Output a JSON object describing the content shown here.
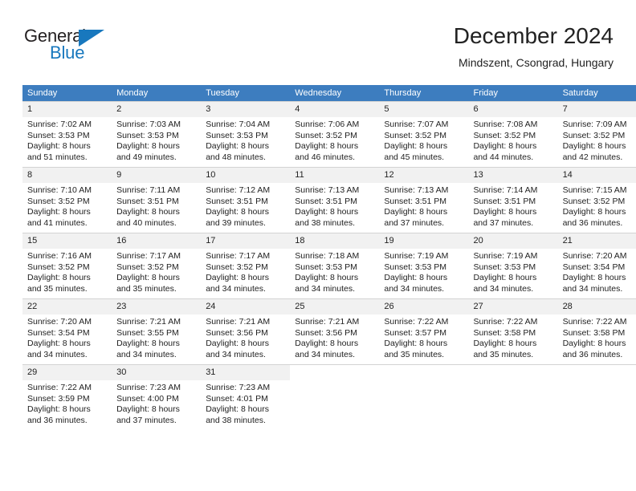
{
  "brand": {
    "name_top": "General",
    "name_bottom": "Blue",
    "color_dark": "#231f20",
    "color_blue": "#1878be"
  },
  "header": {
    "title": "December 2024",
    "subtitle": "Mindszent, Csongrad, Hungary"
  },
  "theme": {
    "header_bg": "#3d7dbf",
    "header_text": "#ffffff",
    "daynum_bg": "#f1f1f1",
    "grid_line": "#d3d3d3"
  },
  "weekdays": [
    "Sunday",
    "Monday",
    "Tuesday",
    "Wednesday",
    "Thursday",
    "Friday",
    "Saturday"
  ],
  "weeks": [
    [
      {
        "day": "1",
        "sunrise": "Sunrise: 7:02 AM",
        "sunset": "Sunset: 3:53 PM",
        "daylight1": "Daylight: 8 hours",
        "daylight2": "and 51 minutes."
      },
      {
        "day": "2",
        "sunrise": "Sunrise: 7:03 AM",
        "sunset": "Sunset: 3:53 PM",
        "daylight1": "Daylight: 8 hours",
        "daylight2": "and 49 minutes."
      },
      {
        "day": "3",
        "sunrise": "Sunrise: 7:04 AM",
        "sunset": "Sunset: 3:53 PM",
        "daylight1": "Daylight: 8 hours",
        "daylight2": "and 48 minutes."
      },
      {
        "day": "4",
        "sunrise": "Sunrise: 7:06 AM",
        "sunset": "Sunset: 3:52 PM",
        "daylight1": "Daylight: 8 hours",
        "daylight2": "and 46 minutes."
      },
      {
        "day": "5",
        "sunrise": "Sunrise: 7:07 AM",
        "sunset": "Sunset: 3:52 PM",
        "daylight1": "Daylight: 8 hours",
        "daylight2": "and 45 minutes."
      },
      {
        "day": "6",
        "sunrise": "Sunrise: 7:08 AM",
        "sunset": "Sunset: 3:52 PM",
        "daylight1": "Daylight: 8 hours",
        "daylight2": "and 44 minutes."
      },
      {
        "day": "7",
        "sunrise": "Sunrise: 7:09 AM",
        "sunset": "Sunset: 3:52 PM",
        "daylight1": "Daylight: 8 hours",
        "daylight2": "and 42 minutes."
      }
    ],
    [
      {
        "day": "8",
        "sunrise": "Sunrise: 7:10 AM",
        "sunset": "Sunset: 3:52 PM",
        "daylight1": "Daylight: 8 hours",
        "daylight2": "and 41 minutes."
      },
      {
        "day": "9",
        "sunrise": "Sunrise: 7:11 AM",
        "sunset": "Sunset: 3:51 PM",
        "daylight1": "Daylight: 8 hours",
        "daylight2": "and 40 minutes."
      },
      {
        "day": "10",
        "sunrise": "Sunrise: 7:12 AM",
        "sunset": "Sunset: 3:51 PM",
        "daylight1": "Daylight: 8 hours",
        "daylight2": "and 39 minutes."
      },
      {
        "day": "11",
        "sunrise": "Sunrise: 7:13 AM",
        "sunset": "Sunset: 3:51 PM",
        "daylight1": "Daylight: 8 hours",
        "daylight2": "and 38 minutes."
      },
      {
        "day": "12",
        "sunrise": "Sunrise: 7:13 AM",
        "sunset": "Sunset: 3:51 PM",
        "daylight1": "Daylight: 8 hours",
        "daylight2": "and 37 minutes."
      },
      {
        "day": "13",
        "sunrise": "Sunrise: 7:14 AM",
        "sunset": "Sunset: 3:51 PM",
        "daylight1": "Daylight: 8 hours",
        "daylight2": "and 37 minutes."
      },
      {
        "day": "14",
        "sunrise": "Sunrise: 7:15 AM",
        "sunset": "Sunset: 3:52 PM",
        "daylight1": "Daylight: 8 hours",
        "daylight2": "and 36 minutes."
      }
    ],
    [
      {
        "day": "15",
        "sunrise": "Sunrise: 7:16 AM",
        "sunset": "Sunset: 3:52 PM",
        "daylight1": "Daylight: 8 hours",
        "daylight2": "and 35 minutes."
      },
      {
        "day": "16",
        "sunrise": "Sunrise: 7:17 AM",
        "sunset": "Sunset: 3:52 PM",
        "daylight1": "Daylight: 8 hours",
        "daylight2": "and 35 minutes."
      },
      {
        "day": "17",
        "sunrise": "Sunrise: 7:17 AM",
        "sunset": "Sunset: 3:52 PM",
        "daylight1": "Daylight: 8 hours",
        "daylight2": "and 34 minutes."
      },
      {
        "day": "18",
        "sunrise": "Sunrise: 7:18 AM",
        "sunset": "Sunset: 3:53 PM",
        "daylight1": "Daylight: 8 hours",
        "daylight2": "and 34 minutes."
      },
      {
        "day": "19",
        "sunrise": "Sunrise: 7:19 AM",
        "sunset": "Sunset: 3:53 PM",
        "daylight1": "Daylight: 8 hours",
        "daylight2": "and 34 minutes."
      },
      {
        "day": "20",
        "sunrise": "Sunrise: 7:19 AM",
        "sunset": "Sunset: 3:53 PM",
        "daylight1": "Daylight: 8 hours",
        "daylight2": "and 34 minutes."
      },
      {
        "day": "21",
        "sunrise": "Sunrise: 7:20 AM",
        "sunset": "Sunset: 3:54 PM",
        "daylight1": "Daylight: 8 hours",
        "daylight2": "and 34 minutes."
      }
    ],
    [
      {
        "day": "22",
        "sunrise": "Sunrise: 7:20 AM",
        "sunset": "Sunset: 3:54 PM",
        "daylight1": "Daylight: 8 hours",
        "daylight2": "and 34 minutes."
      },
      {
        "day": "23",
        "sunrise": "Sunrise: 7:21 AM",
        "sunset": "Sunset: 3:55 PM",
        "daylight1": "Daylight: 8 hours",
        "daylight2": "and 34 minutes."
      },
      {
        "day": "24",
        "sunrise": "Sunrise: 7:21 AM",
        "sunset": "Sunset: 3:56 PM",
        "daylight1": "Daylight: 8 hours",
        "daylight2": "and 34 minutes."
      },
      {
        "day": "25",
        "sunrise": "Sunrise: 7:21 AM",
        "sunset": "Sunset: 3:56 PM",
        "daylight1": "Daylight: 8 hours",
        "daylight2": "and 34 minutes."
      },
      {
        "day": "26",
        "sunrise": "Sunrise: 7:22 AM",
        "sunset": "Sunset: 3:57 PM",
        "daylight1": "Daylight: 8 hours",
        "daylight2": "and 35 minutes."
      },
      {
        "day": "27",
        "sunrise": "Sunrise: 7:22 AM",
        "sunset": "Sunset: 3:58 PM",
        "daylight1": "Daylight: 8 hours",
        "daylight2": "and 35 minutes."
      },
      {
        "day": "28",
        "sunrise": "Sunrise: 7:22 AM",
        "sunset": "Sunset: 3:58 PM",
        "daylight1": "Daylight: 8 hours",
        "daylight2": "and 36 minutes."
      }
    ],
    [
      {
        "day": "29",
        "sunrise": "Sunrise: 7:22 AM",
        "sunset": "Sunset: 3:59 PM",
        "daylight1": "Daylight: 8 hours",
        "daylight2": "and 36 minutes."
      },
      {
        "day": "30",
        "sunrise": "Sunrise: 7:23 AM",
        "sunset": "Sunset: 4:00 PM",
        "daylight1": "Daylight: 8 hours",
        "daylight2": "and 37 minutes."
      },
      {
        "day": "31",
        "sunrise": "Sunrise: 7:23 AM",
        "sunset": "Sunset: 4:01 PM",
        "daylight1": "Daylight: 8 hours",
        "daylight2": "and 38 minutes."
      },
      null,
      null,
      null,
      null
    ]
  ]
}
